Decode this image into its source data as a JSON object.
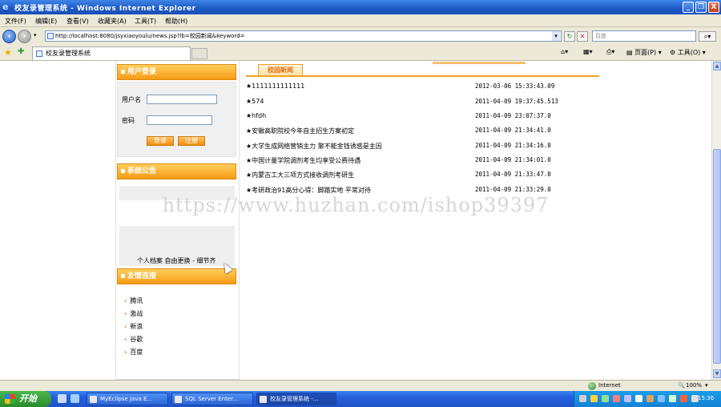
{
  "window": {
    "title": "校友录管理系统 - Windows Internet Explorer",
    "controls": [
      "_",
      "❐",
      "X"
    ]
  },
  "menubar": [
    "文件(F)",
    "编辑(E)",
    "查看(V)",
    "收藏夹(A)",
    "工具(T)",
    "帮助(H)"
  ],
  "address": {
    "url": "http://localhost:8080/jsyxiaoyoulu/news.jsp?lb=校园新闻&keyword=",
    "search_placeholder": "百度"
  },
  "tab": {
    "title": "校友录管理系统"
  },
  "command_bar": {
    "page_label": "页面(P)",
    "tools_label": "工具(O)"
  },
  "sidebar": {
    "login": {
      "header": "用户登录",
      "username_label": "用户名",
      "password_label": "密码",
      "login_button": "登录",
      "register_button": "注册"
    },
    "announcement": {
      "header": "系统公告",
      "snippet": "个人档案 自由更换 - 细节齐"
    },
    "links": {
      "header": "友情连接",
      "items": [
        "腾讯",
        "激战",
        "新浪",
        "谷歌",
        "百度"
      ]
    }
  },
  "news": {
    "header": "校园新闻",
    "items": [
      {
        "title": "★1111111111111",
        "date": "2012-03-06 15:33:43.09"
      },
      {
        "title": "★574",
        "date": "2011-04-09 19:37:45.513"
      },
      {
        "title": "★hfdh",
        "date": "2011-04-09 23:07:37.0"
      },
      {
        "title": "★安徽高职院校今年自主招生方案初定",
        "date": "2011-04-09 21:34:41.0"
      },
      {
        "title": "★大学生成网络营销主力 聚不能金钱诱惑是主因",
        "date": "2011-04-09 21:34:16.0"
      },
      {
        "title": "★中国计量学院调剂考生均享受公费待遇",
        "date": "2011-04-09 21:34:01.0"
      },
      {
        "title": "★内蒙古工大三项方式接收调剂考研生",
        "date": "2011-04-09 21:33:47.0"
      },
      {
        "title": "★考研政治91高分心得：脚踏实地 平常对待",
        "date": "2011-04-09 21:33:29.0"
      }
    ]
  },
  "watermark": "https://www.huzhan.com/ishop39397",
  "statusbar": {
    "zone": "Internet",
    "zoom": "100%"
  },
  "taskbar": {
    "start_label": "开始",
    "tasks": [
      "MyEclipse Java E...",
      "SQL Server Enter...",
      "校友录管理系统 -..."
    ],
    "clock": "15:36"
  }
}
